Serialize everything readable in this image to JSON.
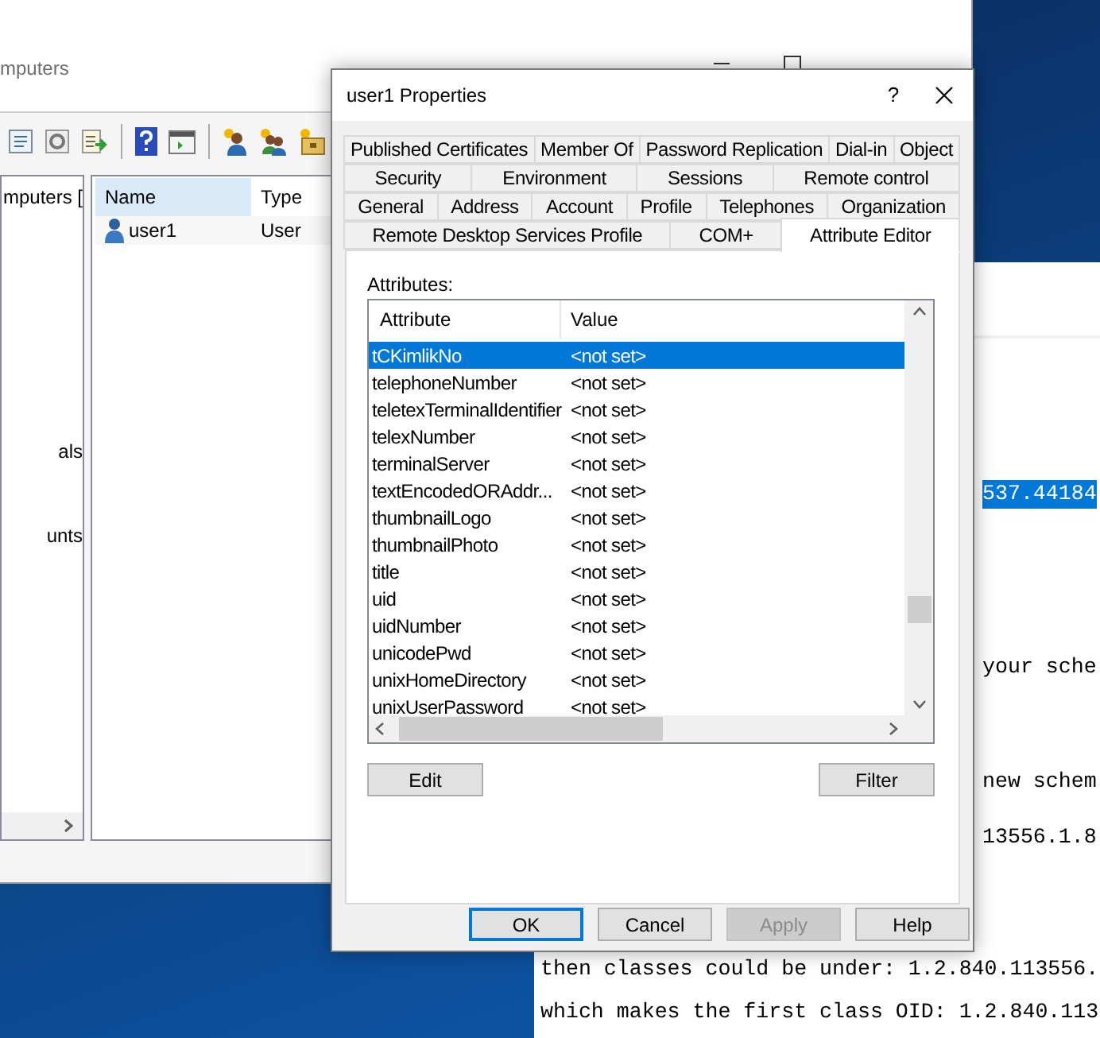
{
  "background_window": {
    "title": "mputers",
    "tree_items": [
      "mputers [",
      "als",
      "unts"
    ],
    "columns": [
      {
        "label": "Name",
        "selected": true
      },
      {
        "label": "Type",
        "selected": false
      }
    ],
    "rows": [
      {
        "name": "user1",
        "type": "User"
      }
    ]
  },
  "text_window": {
    "lines": [
      {
        "text": "537.44184",
        "selected": true
      },
      {
        "text": "your sche",
        "selected": false
      },
      {
        "text": "new schem",
        "selected": false
      },
      {
        "text": "13556.1.8",
        "selected": false
      },
      {
        "text": "then classes could be under: 1.2.840.113556.",
        "selected": false
      },
      {
        "text": "which makes the first class OID: 1.2.840.113",
        "selected": false
      }
    ]
  },
  "dialog": {
    "title": "user1 Properties",
    "help_glyph": "?",
    "tab_rows": [
      [
        {
          "label": "Published Certificates",
          "selected": false
        },
        {
          "label": "Member Of",
          "selected": false
        },
        {
          "label": "Password Replication",
          "selected": false
        },
        {
          "label": "Dial-in",
          "selected": false
        },
        {
          "label": "Object",
          "selected": false
        }
      ],
      [
        {
          "label": "Security",
          "selected": false
        },
        {
          "label": "Environment",
          "selected": false
        },
        {
          "label": "Sessions",
          "selected": false
        },
        {
          "label": "Remote control",
          "selected": false
        }
      ],
      [
        {
          "label": "General",
          "selected": false
        },
        {
          "label": "Address",
          "selected": false
        },
        {
          "label": "Account",
          "selected": false
        },
        {
          "label": "Profile",
          "selected": false
        },
        {
          "label": "Telephones",
          "selected": false
        },
        {
          "label": "Organization",
          "selected": false
        }
      ],
      [
        {
          "label": "Remote Desktop Services Profile",
          "selected": false
        },
        {
          "label": "COM+",
          "selected": false
        },
        {
          "label": "Attribute Editor",
          "selected": true
        }
      ]
    ],
    "attributes_label": "Attributes:",
    "columns": [
      "Attribute",
      "Value"
    ],
    "rows": [
      {
        "attribute": "tCKimlikNo",
        "value": "<not set>",
        "selected": true
      },
      {
        "attribute": "telephoneNumber",
        "value": "<not set>",
        "selected": false
      },
      {
        "attribute": "teletexTerminalIdentifier",
        "value": "<not set>",
        "selected": false
      },
      {
        "attribute": "telexNumber",
        "value": "<not set>",
        "selected": false
      },
      {
        "attribute": "terminalServer",
        "value": "<not set>",
        "selected": false
      },
      {
        "attribute": "textEncodedORAddr...",
        "value": "<not set>",
        "selected": false
      },
      {
        "attribute": "thumbnailLogo",
        "value": "<not set>",
        "selected": false
      },
      {
        "attribute": "thumbnailPhoto",
        "value": "<not set>",
        "selected": false
      },
      {
        "attribute": "title",
        "value": "<not set>",
        "selected": false
      },
      {
        "attribute": "uid",
        "value": "<not set>",
        "selected": false
      },
      {
        "attribute": "uidNumber",
        "value": "<not set>",
        "selected": false
      },
      {
        "attribute": "unicodePwd",
        "value": "<not set>",
        "selected": false
      },
      {
        "attribute": "unixHomeDirectory",
        "value": "<not set>",
        "selected": false
      },
      {
        "attribute": "unixUserPassword",
        "value": "<not set>",
        "selected": false
      }
    ],
    "edit_button": "Edit",
    "filter_button": "Filter",
    "buttons": [
      {
        "label": "OK",
        "focused": true,
        "disabled": false
      },
      {
        "label": "Cancel",
        "focused": false,
        "disabled": false
      },
      {
        "label": "Apply",
        "focused": false,
        "disabled": true
      },
      {
        "label": "Help",
        "focused": false,
        "disabled": false
      }
    ]
  }
}
